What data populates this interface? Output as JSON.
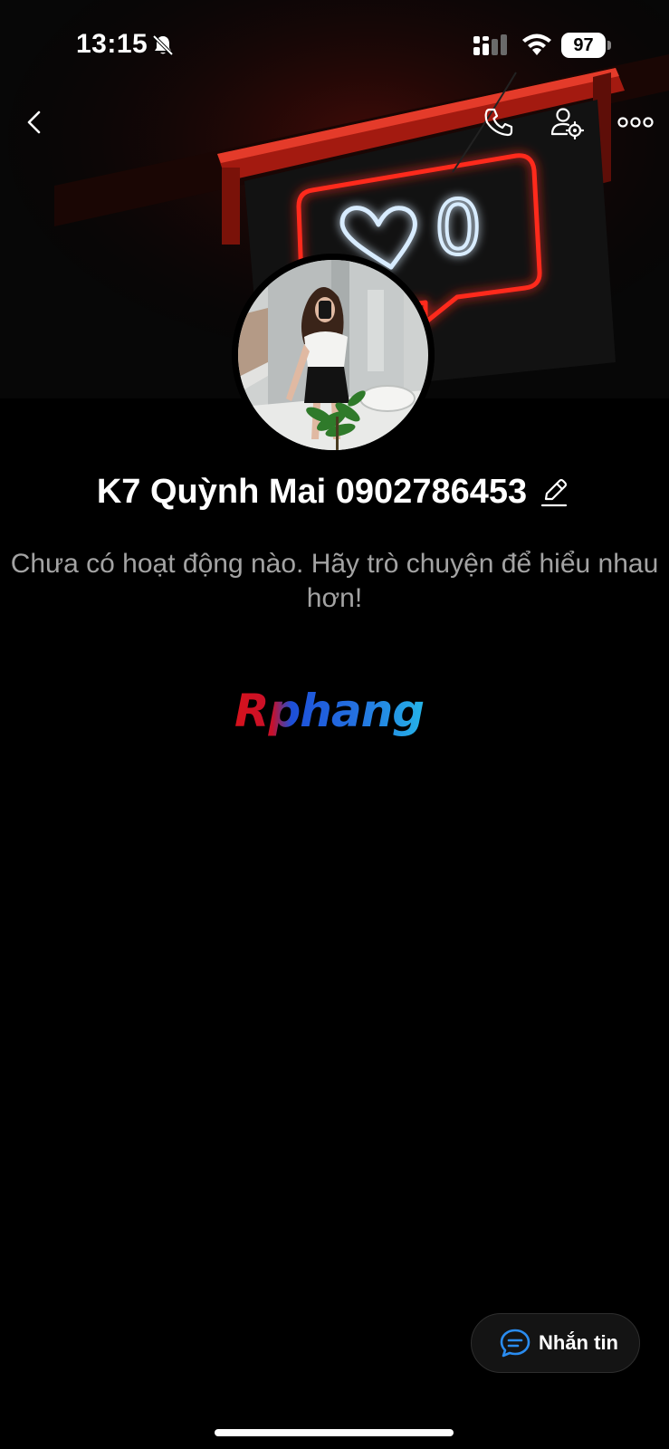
{
  "status_bar": {
    "time": "13:15",
    "battery": "97",
    "icons": [
      "bell-slash-icon",
      "cellular-signal-icon",
      "wifi-icon",
      "battery-icon"
    ]
  },
  "header": {
    "icons": [
      "chevron-left-icon",
      "phone-icon",
      "user-gear-icon",
      "ellipsis-icon"
    ]
  },
  "cover": {
    "neon_text": "0"
  },
  "profile": {
    "name": "K7 Quỳnh Mai 0902786453"
  },
  "empty_state": {
    "message": "Chưa có hoạt động nào. Hãy trò chuyện để hiểu nhau hơn!"
  },
  "watermark": {
    "text": "Rphang",
    "colors": [
      "#d6121c",
      "#1d4fd8",
      "#25b4e8"
    ]
  },
  "fab": {
    "label": "Nhắn tin",
    "accent": "#2a8cf0"
  },
  "colors": {
    "background": "#000000",
    "secondary_text": "#a3a3a3",
    "neon_red": "#ff2a1f",
    "neon_blue": "#cfe6ff"
  }
}
